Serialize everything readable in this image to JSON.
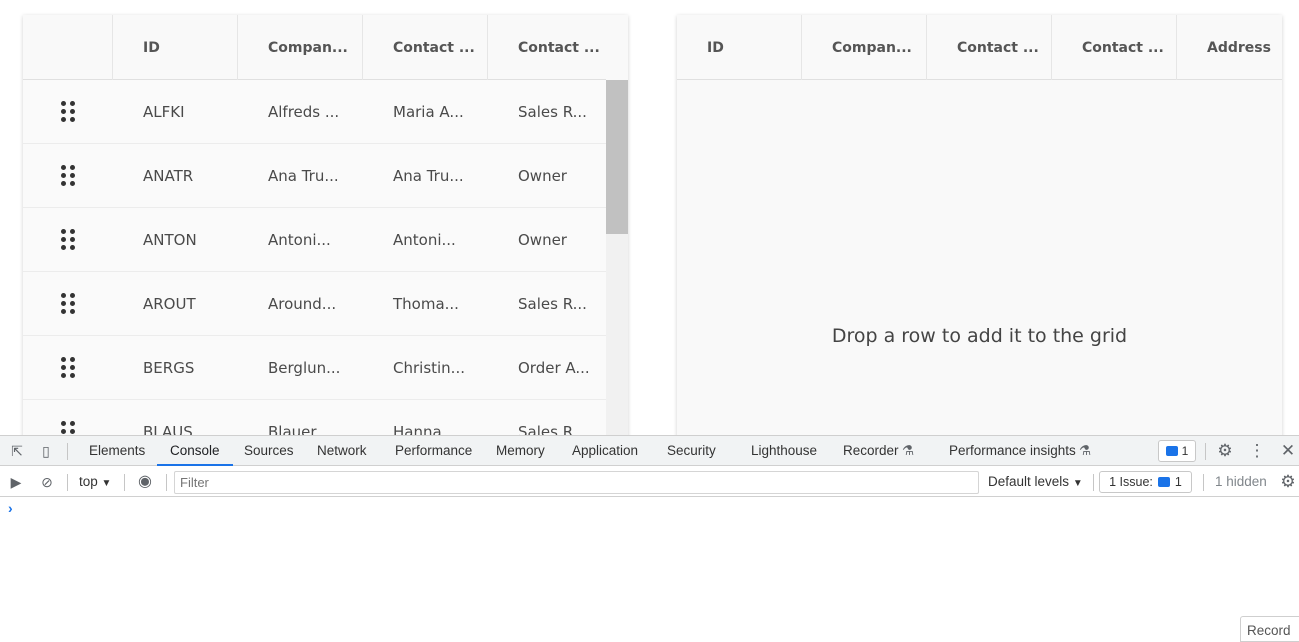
{
  "left_grid": {
    "columns": [
      "",
      "ID",
      "Compan...",
      "Contact ...",
      "Contact ..."
    ],
    "rows": [
      {
        "id": "ALFKI",
        "company": "Alfreds ...",
        "contact_name": "Maria A...",
        "contact_title": "Sales R..."
      },
      {
        "id": "ANATR",
        "company": "Ana Tru...",
        "contact_name": "Ana Tru...",
        "contact_title": "Owner"
      },
      {
        "id": "ANTON",
        "company": "Antoni...",
        "contact_name": "Antoni...",
        "contact_title": "Owner"
      },
      {
        "id": "AROUT",
        "company": "Around...",
        "contact_name": "Thoma...",
        "contact_title": "Sales R..."
      },
      {
        "id": "BERGS",
        "company": "Berglun...",
        "contact_name": "Christin...",
        "contact_title": "Order A..."
      },
      {
        "id": "BLAUS",
        "company": "Blauer...",
        "contact_name": "Hanna...",
        "contact_title": "Sales R..."
      }
    ],
    "scroll_position": 0.0
  },
  "right_grid": {
    "columns": [
      "ID",
      "Compan...",
      "Contact ...",
      "Contact ...",
      "Address"
    ],
    "empty_message": "Drop a row to add it to the grid"
  },
  "devtools": {
    "tabs": [
      "Elements",
      "Console",
      "Sources",
      "Network",
      "Performance",
      "Memory",
      "Application",
      "Security",
      "Lighthouse",
      "Recorder",
      "Performance insights"
    ],
    "active_tab": "Console",
    "messages_badge": "1",
    "context": "top",
    "filter_placeholder": "Filter",
    "levels": "Default levels",
    "issues_label": "1 Issue:",
    "issues_count": "1",
    "hidden": "1 hidden",
    "prompt": "›",
    "record_button": "Record",
    "accent_color": "#1a73e8"
  }
}
